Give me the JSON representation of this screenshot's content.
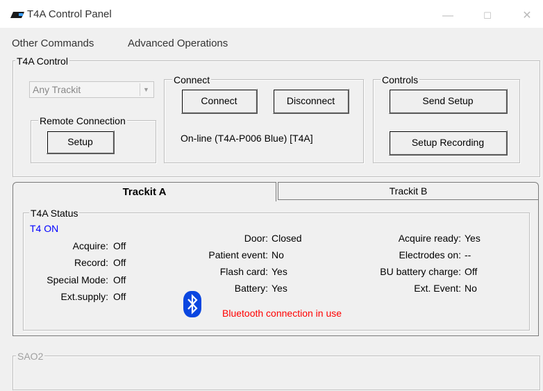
{
  "window": {
    "title": "T4A Control Panel",
    "controls": {
      "minimize": "—",
      "maximize": "☐",
      "close": "✕"
    }
  },
  "menu": [
    "Other Commands",
    "Advanced Operations"
  ],
  "t4a_control": {
    "label": "T4A Control",
    "device_select": {
      "value": "Any Trackit",
      "enabled": false
    },
    "remote_connection": {
      "label": "Remote Connection",
      "setup_button": "Setup"
    },
    "connect": {
      "label": "Connect",
      "connect_button": "Connect",
      "disconnect_button": "Disconnect",
      "status": "On-line (T4A-P006 Blue) [T4A]"
    },
    "controls": {
      "label": "Controls",
      "send_setup_button": "Send Setup",
      "setup_recording_button": "Setup Recording"
    }
  },
  "tabs": [
    {
      "label": "Trackit A",
      "active": true
    },
    {
      "label": "Trackit B",
      "active": false
    }
  ],
  "t4a_status": {
    "label": "T4A Status",
    "state": "T4 ON",
    "state_color": "#0000ff",
    "left": [
      {
        "name": "Acquire:",
        "value": "Off"
      },
      {
        "name": "Record:",
        "value": "Off"
      },
      {
        "name": "Special Mode:",
        "value": "Off"
      },
      {
        "name": "Ext.supply:",
        "value": "Off"
      }
    ],
    "middle": [
      {
        "name": "Door:",
        "value": "Closed"
      },
      {
        "name": "Patient event:",
        "value": "No"
      },
      {
        "name": "Flash card:",
        "value": "Yes"
      },
      {
        "name": "Battery:",
        "value": "Yes"
      }
    ],
    "right": [
      {
        "name": "Acquire ready:",
        "value": "Yes"
      },
      {
        "name": "Electrodes on:",
        "value": "--"
      },
      {
        "name": "BU battery charge:",
        "value": "Off"
      },
      {
        "name": "Ext. Event:",
        "value": "No"
      }
    ],
    "bluetooth_message": "Bluetooth connection in use",
    "bluetooth_color": "#ff0000",
    "bluetooth_icon_color": "#0a46e0"
  },
  "sao2": {
    "label": "SAO2",
    "enabled": false
  }
}
